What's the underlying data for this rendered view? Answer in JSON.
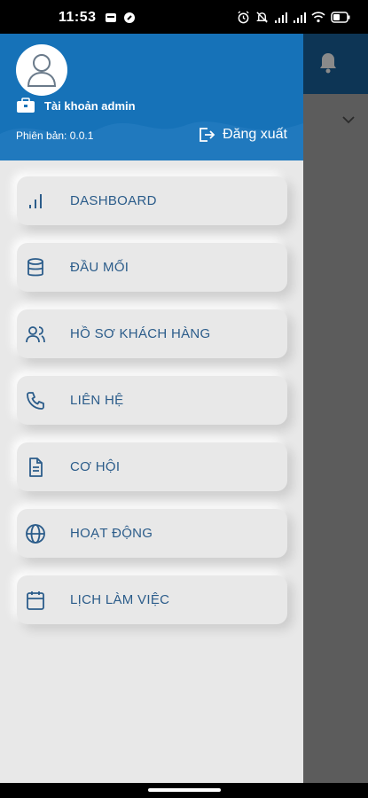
{
  "status_bar": {
    "time": "11:53",
    "left_icons": [
      "notification-square-icon",
      "app-circle-icon"
    ],
    "right_icons": [
      "alarm-icon",
      "mute-icon",
      "signal-icon",
      "signal-icon-2",
      "wifi-icon",
      "battery-icon"
    ]
  },
  "header": {
    "account_name": "Tài khoản admin",
    "version": "Phiên bản: 0.0.1",
    "logout_label": "Đăng xuất"
  },
  "menu": {
    "items": [
      {
        "label": "DASHBOARD",
        "icon": "bar-chart-icon"
      },
      {
        "label": "ĐẦU MỐI",
        "icon": "database-icon"
      },
      {
        "label": "HỒ SƠ KHÁCH HÀNG",
        "icon": "users-icon"
      },
      {
        "label": "LIÊN HỆ",
        "icon": "phone-icon"
      },
      {
        "label": "CƠ HỘI",
        "icon": "document-icon"
      },
      {
        "label": "HOẠT ĐỘNG",
        "icon": "globe-icon"
      },
      {
        "label": "LỊCH LÀM VIỆC",
        "icon": "calendar-icon"
      }
    ]
  },
  "colors": {
    "header_blue": "#1672b8",
    "menu_text": "#2b5c8a",
    "drawer_bg": "#e8e8e8",
    "bg_app_header": "#0d3555"
  }
}
